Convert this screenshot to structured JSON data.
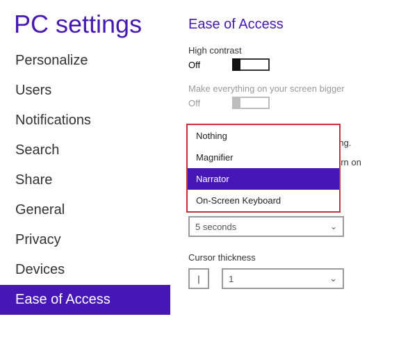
{
  "sidebar": {
    "title": "PC settings",
    "items": [
      {
        "label": "Personalize"
      },
      {
        "label": "Users"
      },
      {
        "label": "Notifications"
      },
      {
        "label": "Search"
      },
      {
        "label": "Share"
      },
      {
        "label": "General"
      },
      {
        "label": "Privacy"
      },
      {
        "label": "Devices"
      },
      {
        "label": "Ease of Access"
      }
    ],
    "active_index": 8
  },
  "main": {
    "section_title": "Ease of Access",
    "high_contrast": {
      "label": "High contrast",
      "state": "Off"
    },
    "magnify": {
      "label": "Make everything on your screen bigger",
      "state": "Off"
    },
    "behind": {
      "line1_tail": "etting.",
      "line2_tail": "ll turn on"
    },
    "dropdown": {
      "options": [
        {
          "label": "Nothing"
        },
        {
          "label": "Magnifier"
        },
        {
          "label": "Narrator"
        },
        {
          "label": "On-Screen Keyboard"
        }
      ],
      "selected_index": 2
    },
    "notification_duration": {
      "value": "5 seconds"
    },
    "cursor": {
      "label": "Cursor thickness",
      "preview": "|",
      "value": "1"
    }
  },
  "icons": {
    "chevron_down": "⌄"
  }
}
